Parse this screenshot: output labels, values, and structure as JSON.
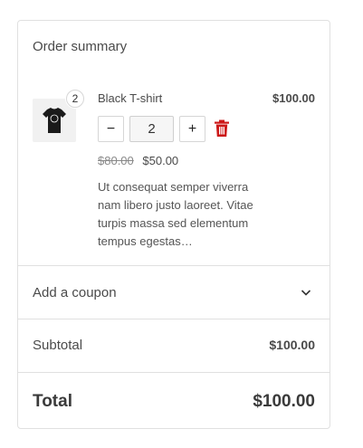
{
  "summary": {
    "title": "Order summary"
  },
  "item": {
    "quantity_badge": "2",
    "name": "Black T-shirt",
    "line_total": "$100.00",
    "quantity_value": "2",
    "minus_label": "−",
    "plus_label": "+",
    "regular_price": "$80.00",
    "sale_price": "$50.00",
    "description": "Ut consequat semper viverra nam libero justo laoreet. Vitae turpis massa sed elementum tempus egestas…"
  },
  "coupon": {
    "label": "Add a coupon",
    "icon": "chevron-down-icon"
  },
  "totals": {
    "subtotal_label": "Subtotal",
    "subtotal_value": "$100.00",
    "total_label": "Total",
    "total_value": "$100.00"
  },
  "colors": {
    "delete_red": "#cc1818",
    "border": "#e0e0e0"
  }
}
